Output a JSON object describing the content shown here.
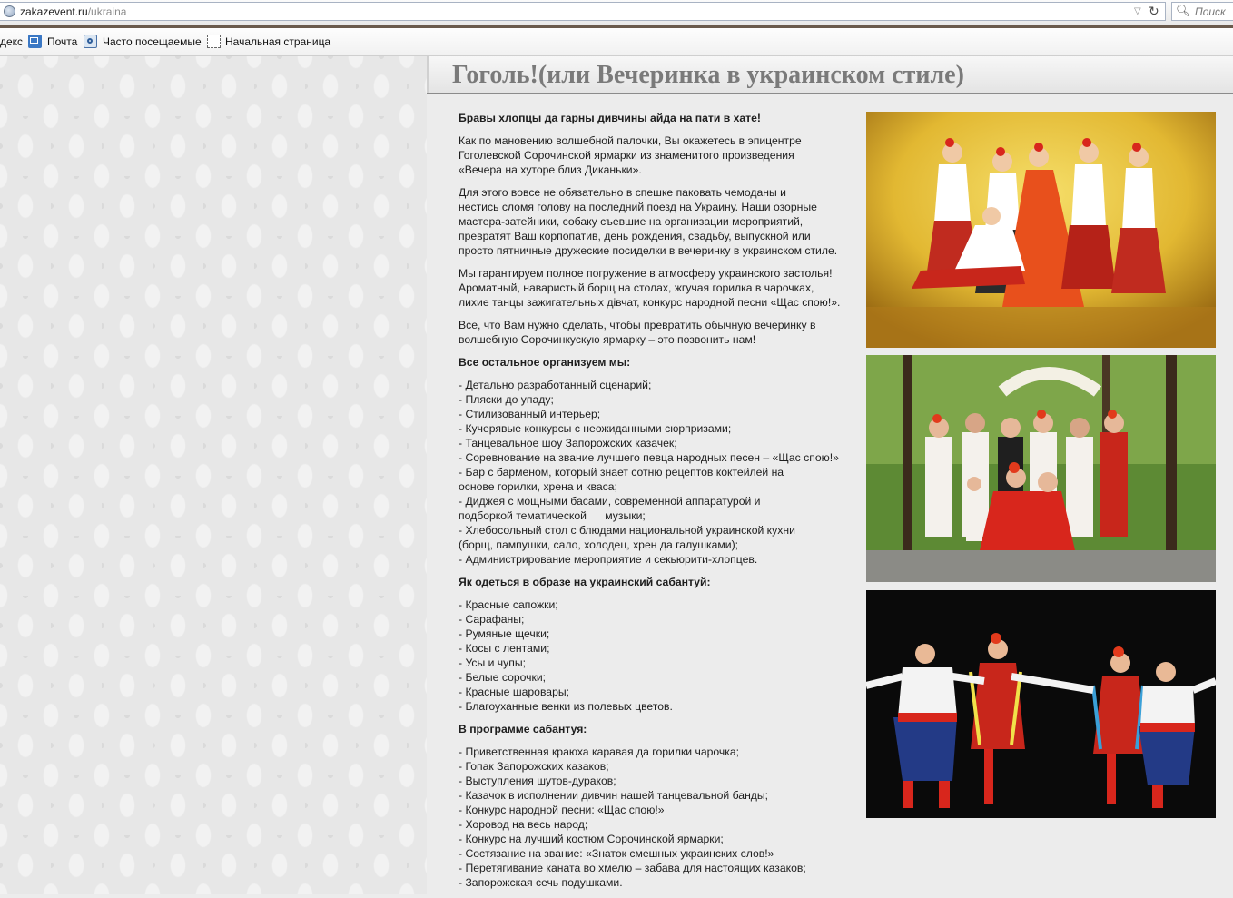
{
  "browser": {
    "url_host": "zakazevent.ru",
    "url_path": "/ukraina",
    "search_placeholder": "Поиск",
    "bookmarks": [
      {
        "label": "декс"
      },
      {
        "label": "Почта",
        "icon": "mail-icon"
      },
      {
        "label": "Часто посещаемые",
        "icon": "frequent-icon"
      },
      {
        "label": "Начальная страница",
        "icon": "page-icon"
      }
    ]
  },
  "article": {
    "title": "Гоголь!(или Вечеринка в украинском стиле)",
    "intro_heading": "Бравы хлопцы да гарны дивчины айда на пати в хате!",
    "paragraphs": [
      " Как по мановению волшебной палочки, Вы окажетесь в эпицентре\nГоголевской Сорочинской ярмарки из знаменитого произведения\n«Вечера на хуторе близ Диканьки».",
      " Для этого вовсе не обязательно в спешке паковать чемоданы и\nнестись сломя голову на последний поезд на Украину. Наши озорные\nмастера-затейники, собаку съевшие на организации мероприятий,\nпревратят Ваш корпопатив, день рождения, свадьбу, выпускной или\nпросто пятничные дружеские посиделки в вечеринку в украинском стиле.",
      " Мы гарантируем полное погружение в атмосферу украинского застолья!\nАроматный, наваристый борщ на столах, жгучая горилка в чарочках,\nлихие танцы зажигательных дівчат, конкурс народной песни «Щас спою!».",
      "Все, что Вам нужно сделать, чтобы превратить обычную вечеринку в\nволшебную Сорочинкускую ярмарку – это позвонить нам!"
    ],
    "organize_heading": "Все остальное организуем мы:",
    "organize_items": [
      "- Детально разработанный сценарий;",
      "- Пляски до упаду;",
      "- Стилизованный интерьер;",
      "- Кучерявые конкурсы с неожиданными сюрпризами;",
      "- Танцевальное шоу Запорожских казачек;",
      "- Соревнование на звание лучшего певца народных песен – «Щас спою!»",
      "- Бар с барменом, который знает сотню рецептов коктейлей на",
      "основе горилки, хрена и кваса;",
      "- Диджея с мощными басами, современной аппаратурой и",
      "подборкой тематической      музыки;",
      "- Хлебосольный стол с блюдами национальной украинской кухни",
      "(борщ, пампушки, сало, холодец, хрен да галушками);",
      "- Администрирование мероприятие и секьюрити-хлопцев."
    ],
    "dress_heading": "Як одеться в образе на украинский сабантуй:",
    "dress_items": [
      "- Красные сапожки;",
      "- Сарафаны;",
      "- Румяные щечки;",
      "- Косы с лентами;",
      "- Усы и чупы;",
      "- Белые сорочки;",
      "- Красные шаровары;",
      "- Благоуханные венки из полевых цветов."
    ],
    "program_heading": "В программе сабантуя:",
    "program_items": [
      "- Приветственная краюха каравая да горилки чарочка;",
      "- Гопак Запорожских казаков;",
      "- Выступления шутов-дураков;",
      "- Казачок в исполнении дивчин нашей танцевальной банды;",
      "- Конкурс народной песни: «Щас спою!»",
      "- Хоровод на весь народ;",
      "- Конкурс на лучший костюм Сорочинской ярмарки;",
      "- Состязание на звание: «Знаток смешных украинских слов!»",
      "- Перетягивание каната во хмелю – забава для настоящих казаков;",
      "- Запорожская сечь подушками."
    ]
  },
  "colors": {
    "title_text": "#7a7a7a",
    "chrome_accent": "#6a5a4c",
    "stage_yellow": "#e9c23a",
    "costume_red": "#d8261c",
    "park_green": "#4f7a2c"
  }
}
